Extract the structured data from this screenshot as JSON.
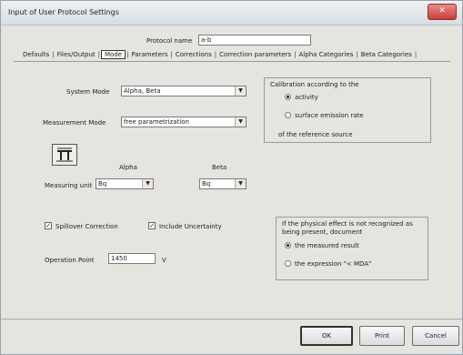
{
  "window": {
    "title": "Input of User Protocol Settings",
    "close_glyph": "✕"
  },
  "protocol": {
    "label": "Protocol name",
    "value": "a-b"
  },
  "tabs": [
    {
      "label": "Defaults"
    },
    {
      "label": "Files/Output"
    },
    {
      "label": "Mode"
    },
    {
      "label": "Parameters"
    },
    {
      "label": "Corrections"
    },
    {
      "label": "Correction parameters"
    },
    {
      "label": "Alpha Categories"
    },
    {
      "label": "Beta Categories"
    }
  ],
  "active_tab": "Mode",
  "system_mode": {
    "label": "System Mode",
    "value": "Alpha, Beta"
  },
  "measurement_mode": {
    "label": "Measurement Mode",
    "value": "free parametrization"
  },
  "calibration": {
    "title": "Calibration according to the",
    "options": [
      "activity",
      "surface emission rate"
    ],
    "selected": "activity",
    "footer": "of the reference source"
  },
  "icon": "pi-symbol-icon",
  "units": {
    "label": "Measuring unit",
    "alpha_header": "Alpha",
    "beta_header": "Beta",
    "alpha_value": "Bq",
    "beta_value": "Bq"
  },
  "checkboxes": {
    "spillover": {
      "label": "Spillover Correction",
      "checked": true
    },
    "uncertainty": {
      "label": "Include Uncertainty",
      "checked": true
    }
  },
  "operation_point": {
    "label": "Operation Point",
    "value": "1450",
    "unit": "V"
  },
  "physical_effect": {
    "title_line1": "If the physical effect is not recognized as",
    "title_line2": "being present, document",
    "options": [
      "the measured result",
      "the expression \"< MDA\""
    ],
    "selected": "the measured result"
  },
  "buttons": {
    "ok": "OK",
    "print": "Print",
    "cancel": "Cancel"
  }
}
